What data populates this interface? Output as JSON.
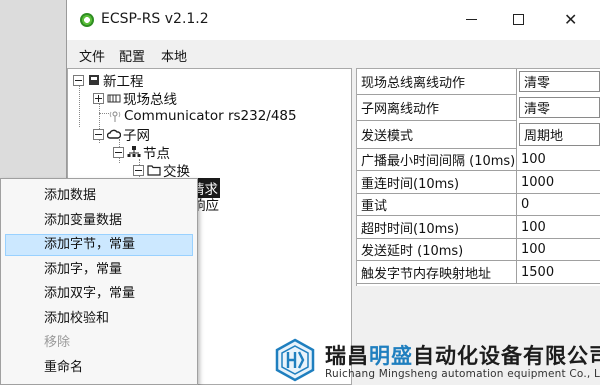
{
  "window": {
    "title": "ECSP-RS v2.1.2",
    "close_glyph": "✕"
  },
  "menu": [
    "文件",
    "配置",
    "本地"
  ],
  "tree": {
    "root": "新工程",
    "fieldbus": "现场总线",
    "communicator": "Communicator rs232/485",
    "subnet": "子网",
    "node": "节点",
    "exchange": "交换",
    "request": "请求",
    "response": "响应"
  },
  "properties": [
    {
      "key": "现场总线离线动作",
      "value": "清零",
      "combo": true
    },
    {
      "key": "子网离线动作",
      "value": "清零",
      "combo": true
    },
    {
      "key": "发送模式",
      "value": "周期地",
      "combo": true
    },
    {
      "key": "广播最小时间间隔 (10ms)",
      "value": "100",
      "combo": false
    },
    {
      "key": "重连时间(10ms)",
      "value": "1000",
      "combo": false
    },
    {
      "key": "重试",
      "value": "0",
      "combo": false
    },
    {
      "key": "超时时间(10ms)",
      "value": "100",
      "combo": false
    },
    {
      "key": "发送延时 (10ms)",
      "value": "100",
      "combo": false
    },
    {
      "key": "触发字节内存映射地址",
      "value": "1500",
      "combo": false
    }
  ],
  "context_menu": [
    {
      "label": "添加数据",
      "state": "normal"
    },
    {
      "label": "添加变量数据",
      "state": "normal"
    },
    {
      "label": "添加字节，常量",
      "state": "hover"
    },
    {
      "label": "添加字，常量",
      "state": "normal"
    },
    {
      "label": "添加双字，常量",
      "state": "normal"
    },
    {
      "label": "添加校验和",
      "state": "normal"
    },
    {
      "label": "移除",
      "state": "disabled"
    },
    {
      "label": "重命名",
      "state": "normal"
    }
  ],
  "watermark": {
    "name_a": "瑞昌",
    "name_b": "明盛",
    "name_c": "自动化设备有限公司",
    "english": "Ruichang Mingsheng automation equipment Co., Ltd"
  },
  "colors": {
    "accent": "#1f7fbf",
    "hover": "#cce8ff",
    "app_icon": "#3fa52e"
  }
}
